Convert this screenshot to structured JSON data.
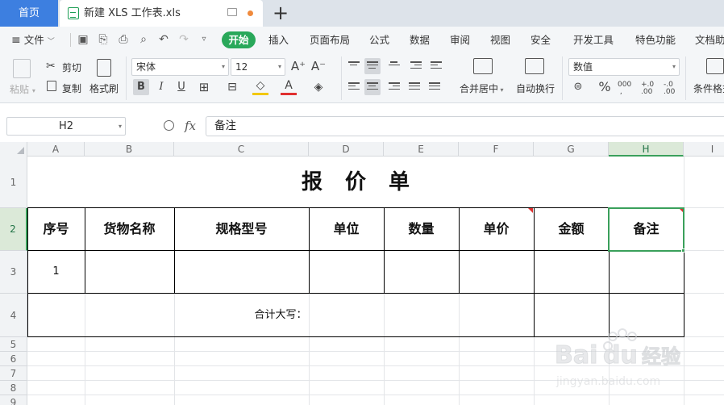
{
  "tabs": {
    "home": "首页",
    "document": "新建 XLS 工作表.xls",
    "new_tab": "+"
  },
  "menu": {
    "file": "文件",
    "items": [
      "开始",
      "插入",
      "页面布局",
      "公式",
      "数据",
      "审阅",
      "视图",
      "安全",
      "开发工具",
      "特色功能",
      "文档助"
    ]
  },
  "ribbon": {
    "paste": "粘贴",
    "cut": "剪切",
    "copy": "复制",
    "format_painter": "格式刷",
    "font_name": "宋体",
    "font_size": "12",
    "bold": "B",
    "italic": "I",
    "underline": "U",
    "merge_center": "合并居中",
    "wrap_text": "自动换行",
    "number_format": "数值",
    "percent": "%",
    "conditional_format": "条件格式"
  },
  "formula_bar": {
    "name_box": "H2",
    "fx": "fx",
    "content": "备注"
  },
  "sheet": {
    "columns": [
      "A",
      "B",
      "C",
      "D",
      "E",
      "F",
      "G",
      "H",
      "I"
    ],
    "rows": [
      "1",
      "2",
      "3",
      "4",
      "5",
      "6",
      "7",
      "8",
      "9"
    ],
    "selected_cell": "H2",
    "title": "报价单",
    "headers": [
      "序号",
      "货物名称",
      "规格型号",
      "单位",
      "数量",
      "单价",
      "金额",
      "备注"
    ],
    "row3_index": "1",
    "total_label": "合计大写："
  },
  "colors": {
    "home_tab": "#3d7fe0",
    "start_button": "#29a85a",
    "selection": "#3aa05b",
    "comment_marker": "#e03030"
  }
}
